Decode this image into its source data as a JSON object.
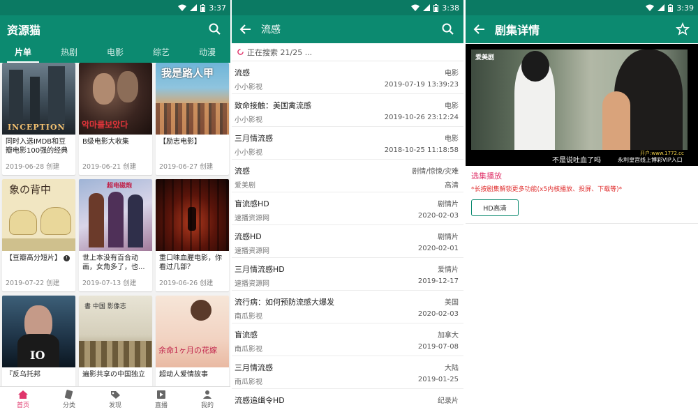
{
  "screen1": {
    "time": "3:37",
    "app_title": "资源猫",
    "tabs": [
      "片单",
      "热剧",
      "电影",
      "综艺",
      "动漫"
    ],
    "cards": [
      {
        "title": "同时入选IMDB和豆瓣电影100强的经典",
        "date": "2019-06-28 创建",
        "poster_text": "INCEPTION"
      },
      {
        "title": "B级电影大收集",
        "date": "2019-06-21 创建",
        "poster_text": "악마를보았다"
      },
      {
        "title": "【励志电影】",
        "date": "2019-06-27 创建",
        "poster_text": "我是路人甲"
      },
      {
        "title": "【豆瓣高分短片】",
        "date": "2019-07-22 创建",
        "poster_text": "象の背中"
      },
      {
        "title": "世上本没有百合动画，女角多了，也...",
        "date": "2019-07-13 创建",
        "poster_text": "超电磁炮"
      },
      {
        "title": "重口味血腥电影，你看过几部？",
        "date": "2019-06-26 创建",
        "poster_text": ""
      },
      {
        "title": "『反乌托邦",
        "date": "",
        "poster_text": "IO"
      },
      {
        "title": "遍影共享の中国独立",
        "date": "",
        "poster_text": "書 中国 影像志"
      },
      {
        "title": "超动人爱情故事",
        "date": "",
        "poster_text": "余命1ヶ月の花嫁"
      }
    ],
    "nav": [
      "首页",
      "分类",
      "发现",
      "直播",
      "我的"
    ]
  },
  "screen2": {
    "time": "3:38",
    "title": "流感",
    "searching": "正在搜索 21/25 ...",
    "results": [
      {
        "title": "流感",
        "tag": "电影",
        "source": "小小影视",
        "date": "2019-07-19 13:39:23"
      },
      {
        "title": "致命接触：美国禽流感",
        "tag": "电影",
        "source": "小小影视",
        "date": "2019-10-26 23:12:24"
      },
      {
        "title": "三月情流感",
        "tag": "电影",
        "source": "小小影视",
        "date": "2018-10-25 11:18:58"
      },
      {
        "title": "流感",
        "tag": "剧情/惊悚/灾难",
        "source": "爱美剧",
        "date": "高清"
      },
      {
        "title": "盲流感HD",
        "tag": "剧情片",
        "source": "速播资源网",
        "date": "2020-02-03"
      },
      {
        "title": "流感HD",
        "tag": "剧情片",
        "source": "速播资源网",
        "date": "2020-02-01"
      },
      {
        "title": "三月情流感HD",
        "tag": "爱情片",
        "source": "速播资源网",
        "date": "2019-12-17"
      },
      {
        "title": "流行病：如何预防流感大爆发",
        "tag": "美国",
        "source": "南瓜影视",
        "date": "2020-02-03"
      },
      {
        "title": "盲流感",
        "tag": "加拿大",
        "source": "南瓜影视",
        "date": "2019-07-08"
      },
      {
        "title": "三月情流感",
        "tag": "大陆",
        "source": "南瓜影视",
        "date": "2019-01-25"
      },
      {
        "title": "流感追缉令HD",
        "tag": "纪录片",
        "source": "",
        "date": ""
      }
    ]
  },
  "screen3": {
    "time": "3:39",
    "title": "剧集详情",
    "video_logo": "爱美剧",
    "subtitle": "不是说吐血了吗",
    "watermark_top": "开户:www.1772.cc",
    "watermark_bottom": "永利皇宫线上博彩VIP入口",
    "section": "选集播放",
    "hint": "*长按剧集解锁更多功能(x5内核播放、投屏、下载等)*",
    "episode": "HD高清"
  },
  "colors": {
    "primary": "#0c8a70",
    "accent": "#e0356b"
  }
}
